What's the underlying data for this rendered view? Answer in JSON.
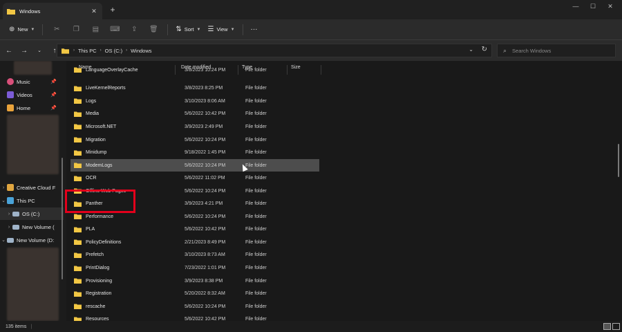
{
  "window": {
    "tab_title": "Windows",
    "new_tab": "+",
    "controls": [
      "—",
      "☐",
      "✕"
    ]
  },
  "toolbar": {
    "new_label": "New",
    "sort_label": "Sort",
    "view_label": "View",
    "more": "···"
  },
  "address": {
    "crumbs": [
      "This PC",
      "OS (C:)",
      "Windows"
    ],
    "search_placeholder": "Search Windows"
  },
  "sidebar": {
    "items": [
      {
        "label": "Music",
        "icon": "music-icon",
        "pinned": true,
        "color": "#d9507a"
      },
      {
        "label": "Videos",
        "icon": "videos-icon",
        "pinned": true,
        "color": "#7c5cd6"
      },
      {
        "label": "Home",
        "icon": "home-icon",
        "pinned": true,
        "color": "#e9a33b"
      },
      {
        "label": "Creative Cloud F",
        "icon": "creative-cloud-icon",
        "color": "#e0a640"
      },
      {
        "label": "This PC",
        "icon": "this-pc-icon",
        "color": "#4aa3d8"
      },
      {
        "label": "OS (C:)",
        "icon": "drive-icon",
        "color": "#9fb3c8"
      },
      {
        "label": "New Volume (",
        "icon": "drive-icon",
        "color": "#9fb3c8"
      },
      {
        "label": "New Volume (D:",
        "icon": "drive-icon",
        "color": "#9fb3c8"
      }
    ]
  },
  "columns": {
    "name": "Name",
    "date": "Date modified",
    "type": "Type",
    "size": "Size"
  },
  "files": [
    {
      "name": "LanguageOverlayCache",
      "date": "3/8/2023 10:24 PM",
      "type": "File folder"
    },
    {
      "name": "LiveKernelReports",
      "date": "3/8/2023 8:25 PM",
      "type": "File folder"
    },
    {
      "name": "Logs",
      "date": "3/10/2023 8:06 AM",
      "type": "File folder"
    },
    {
      "name": "Media",
      "date": "5/6/2022 10:42 PM",
      "type": "File folder"
    },
    {
      "name": "Microsoft.NET",
      "date": "3/9/2023 2:49 PM",
      "type": "File folder"
    },
    {
      "name": "Migration",
      "date": "5/6/2022 10:24 PM",
      "type": "File folder"
    },
    {
      "name": "Minidump",
      "date": "9/18/2022 1:45 PM",
      "type": "File folder"
    },
    {
      "name": "ModemLogs",
      "date": "5/6/2022 10:24 PM",
      "type": "File folder"
    },
    {
      "name": "OCR",
      "date": "5/6/2022 11:02 PM",
      "type": "File folder"
    },
    {
      "name": "Offline Web Pages",
      "date": "5/6/2022 10:24 PM",
      "type": "File folder"
    },
    {
      "name": "Panther",
      "date": "3/9/2023 4:21 PM",
      "type": "File folder"
    },
    {
      "name": "Performance",
      "date": "5/6/2022 10:24 PM",
      "type": "File folder"
    },
    {
      "name": "PLA",
      "date": "5/6/2022 10:42 PM",
      "type": "File folder"
    },
    {
      "name": "PolicyDefinitions",
      "date": "2/21/2023 8:49 PM",
      "type": "File folder"
    },
    {
      "name": "Prefetch",
      "date": "3/10/2023 8:73 AM",
      "type": "File folder"
    },
    {
      "name": "PrintDialog",
      "date": "7/23/2022 1:01 PM",
      "type": "File folder"
    },
    {
      "name": "Provisioning",
      "date": "3/9/2023 8:38 PM",
      "type": "File folder"
    },
    {
      "name": "Registration",
      "date": "5/20/2022 8:32 AM",
      "type": "File folder"
    },
    {
      "name": "rescache",
      "date": "5/6/2022 10:24 PM",
      "type": "File folder"
    },
    {
      "name": "Resources",
      "date": "5/6/2022 10:42 PM",
      "type": "File folder"
    }
  ],
  "status": {
    "items_count": "135 items"
  },
  "colors": {
    "folder": "#f2c744",
    "highlight": "#e3001b",
    "hover_row": "#4d4d4d"
  }
}
